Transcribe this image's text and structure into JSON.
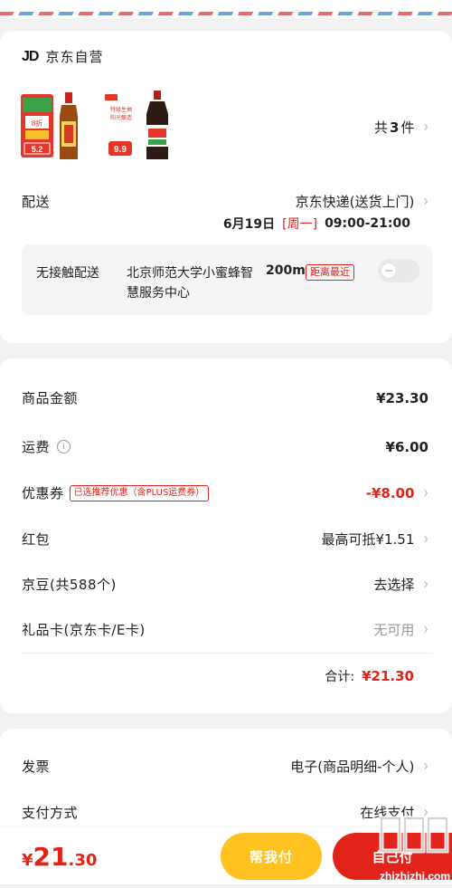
{
  "store": {
    "logo_text": "JD",
    "name": "京东自营",
    "items_prefix": "共",
    "items_count": "3",
    "items_suffix": "件",
    "products": [
      {
        "icon": "product-thumbnail",
        "texts": [
          "8折",
          "5.2"
        ]
      },
      {
        "icon": "product-thumbnail",
        "texts": [
          "特级生抽",
          "9.9"
        ]
      }
    ]
  },
  "shipping": {
    "label": "配送",
    "method": "京东快递(送货上门)",
    "date": "6月19日",
    "weekday": "[周一]",
    "time": "09:00-21:00"
  },
  "contactless": {
    "label": "无接触配送",
    "location": "北京师范大学小蜜蜂智慧服务中心",
    "distance": "200m",
    "badge": "距离最近",
    "enabled": false
  },
  "summary": {
    "goods_amount_label": "商品金额",
    "goods_amount": "¥23.30",
    "freight_label": "运费",
    "freight": "¥6.00",
    "coupon_label": "优惠券",
    "coupon_tag": "已选推荐优惠（含PLUS运费券）",
    "coupon_value": "-¥8.00",
    "redpacket_label": "红包",
    "redpacket_value": "最高可抵¥1.51",
    "jingdou_label": "京豆(共588个)",
    "jingdou_value": "去选择",
    "giftcard_label": "礼品卡(京东卡/E卡)",
    "giftcard_value": "无可用",
    "total_label": "合计:",
    "total_value": "¥21.30"
  },
  "invoice": {
    "label": "发票",
    "value": "电子(商品明细-个人)"
  },
  "payment": {
    "label": "支付方式",
    "value": "在线支付"
  },
  "footer": {
    "price_symbol": "¥",
    "price_int": "21",
    "price_dec": ".30",
    "help_pay": "帮我付",
    "submit": "自己付"
  },
  "watermark": {
    "text": "值 什么值得买",
    "domain": "zhizhizhi.com"
  },
  "colors": {
    "accent_red": "#e2231a",
    "help_yellow": "#ffc220",
    "background": "#f2f2f2"
  }
}
